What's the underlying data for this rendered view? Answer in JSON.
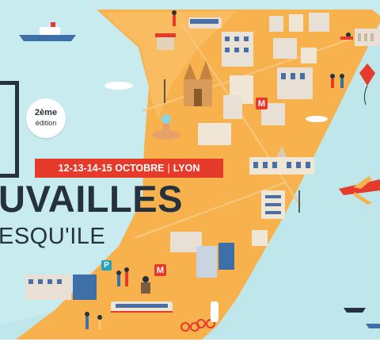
{
  "edition": {
    "number": "2ème",
    "word": "édition"
  },
  "dates": {
    "days": "12-13-14-15 OCTOBRE",
    "separator": "|",
    "city": "LYON"
  },
  "title": {
    "main": "UVAILLES",
    "sub": "ESQU'ILE"
  },
  "signs": {
    "metro": "M",
    "parking": "P"
  },
  "colors": {
    "water": "#bfe6ea",
    "peninsula": "#f7b24e",
    "peninsula_light": "#f9c16a",
    "banner": "#e63a2b",
    "text": "#25323d"
  }
}
